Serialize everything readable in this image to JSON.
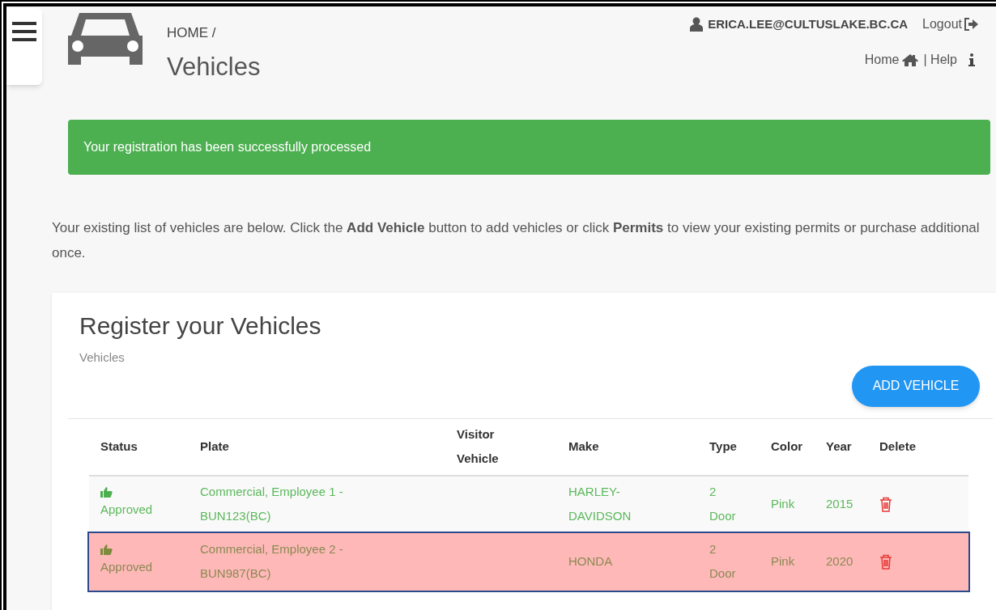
{
  "header": {
    "breadcrumb": "HOME /",
    "title": "Vehicles",
    "user": "ERICA.LEE@CULTUSLAKE.BC.CA",
    "logout": "Logout",
    "home_link": "Home",
    "help_link": "| Help"
  },
  "alert": {
    "message": "Your registration has been successfully processed"
  },
  "intro": "Your existing list of vehicles are below. Click the **Add Vehicle** button to add vehicles or click **Permits** to view your existing permits or purchase additional once.",
  "card": {
    "title": "Register your Vehicles",
    "subtitle": "Vehicles",
    "add_button": "ADD VEHICLE"
  },
  "table": {
    "columns": [
      "Status",
      "Plate",
      "Visitor Vehicle",
      "Make",
      "Type",
      "Color",
      "Year",
      "Delete"
    ],
    "rows": [
      {
        "status": "Approved",
        "plate": "Commercial, Employee 1 - BUN123(BC)",
        "make": "HARLEY-DAVIDSON",
        "type": "2 Door",
        "vehicle_color": "Pink",
        "year": "2015",
        "selected": false
      },
      {
        "status": "Approved",
        "plate": "Commercial, Employee 2 - BUN987(BC)",
        "make": "HONDA",
        "type": "2 Door",
        "vehicle_color": "Pink",
        "year": "2020",
        "selected": true
      }
    ]
  }
}
